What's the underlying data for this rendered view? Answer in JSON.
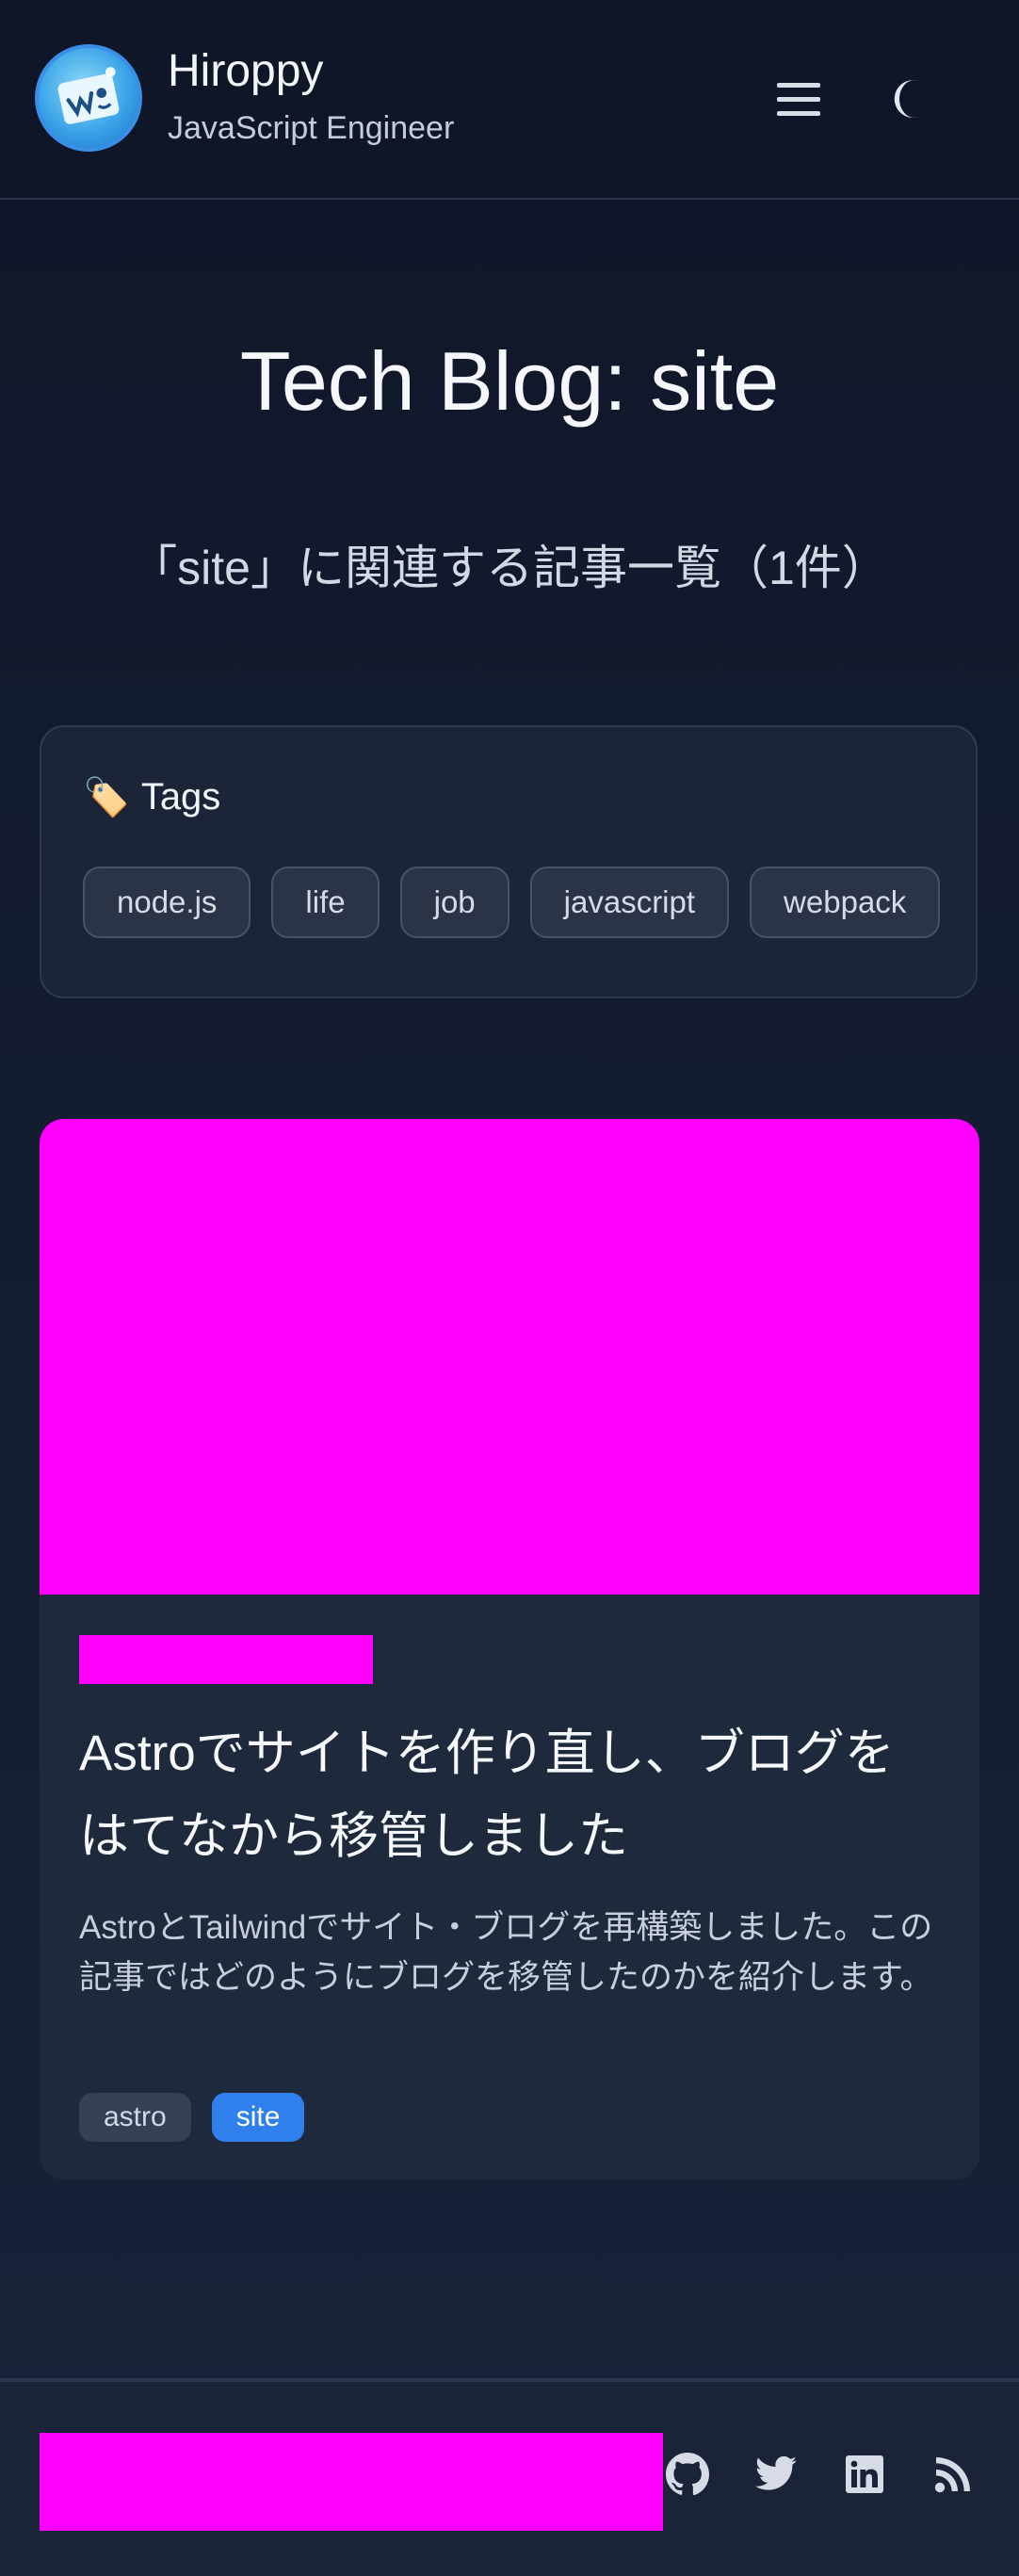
{
  "header": {
    "name": "Hiroppy",
    "subtitle": "JavaScript Engineer",
    "menu_icon": "hamburger-menu-icon",
    "theme_icon": "moon-icon"
  },
  "main": {
    "title": "Tech Blog: site",
    "subtitle": "「site」に関連する記事一覧（1件）"
  },
  "tags_panel": {
    "icon": "🏷️",
    "heading": "Tags",
    "tags": [
      "node.js",
      "life",
      "job",
      "javascript",
      "webpack"
    ]
  },
  "article": {
    "title": "Astroでサイトを作り直し、ブログをはてなから移管しました",
    "description": "AstroとTailwindでサイト・ブログを再構築しました。この記事ではどのようにブログを移管したのかを紹介します。",
    "tags": [
      "astro",
      "site"
    ],
    "active_tag": "site"
  },
  "footer": {
    "social_icons": [
      "github-icon",
      "twitter-icon",
      "linkedin-icon",
      "rss-icon"
    ]
  },
  "colors": {
    "background": "#131b2e",
    "card": "#1e293b",
    "accent": "#2f80ed",
    "placeholder": "#ff00ff"
  }
}
